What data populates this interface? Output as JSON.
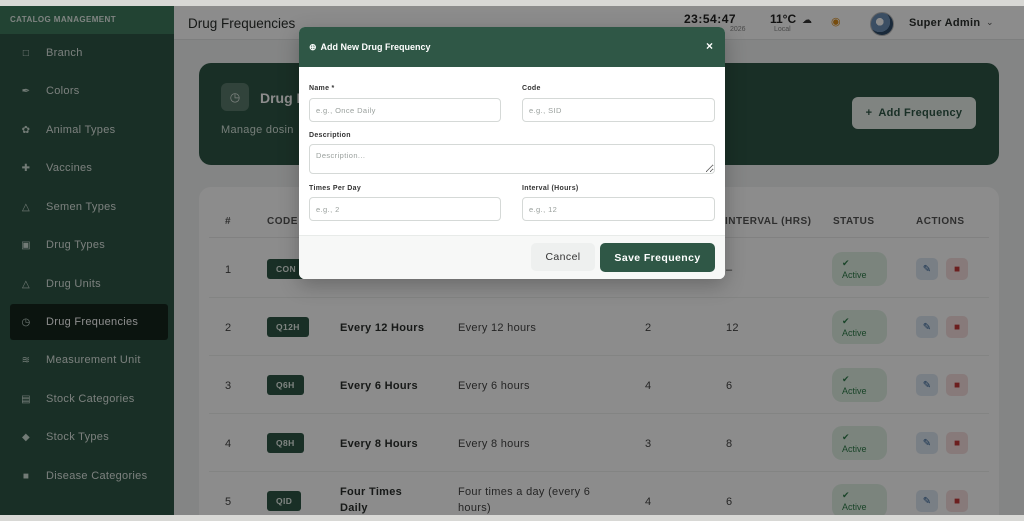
{
  "sidebar": {
    "heading": "CATALOG MANAGEMENT",
    "items": [
      {
        "label": "Branch",
        "icon": "building-icon"
      },
      {
        "label": "Colors",
        "icon": "brush-icon"
      },
      {
        "label": "Animal Types",
        "icon": "paw-icon"
      },
      {
        "label": "Vaccines",
        "icon": "medkit-icon"
      },
      {
        "label": "Semen Types",
        "icon": "flask-icon"
      },
      {
        "label": "Drug Types",
        "icon": "pill-box-icon"
      },
      {
        "label": "Drug Units",
        "icon": "flask-icon"
      },
      {
        "label": "Drug Frequencies",
        "icon": "clock-icon",
        "active": true
      },
      {
        "label": "Measurement Unit",
        "icon": "ruler-icon"
      },
      {
        "label": "Stock Categories",
        "icon": "boxes-icon"
      },
      {
        "label": "Stock Types",
        "icon": "tag-icon"
      },
      {
        "label": "Disease Categories",
        "icon": "folder-icon"
      }
    ]
  },
  "header": {
    "title": "Drug Frequencies",
    "time": "23:54:47",
    "date_partial": "2026",
    "temperature": "11°C",
    "weather_label": "Local",
    "user_name": "Super Admin"
  },
  "banner": {
    "title_partial": "Drug F",
    "subtitle_partial": "Manage dosin",
    "add_button": "Add Frequency"
  },
  "table": {
    "headers": {
      "num": "#",
      "code": "CODE",
      "interval": "INTERVAL (HRS)",
      "status": "STATUS",
      "actions": "ACTIONS"
    },
    "rows": [
      {
        "num": "1",
        "code": "CON",
        "name": "",
        "description": "",
        "times": "",
        "interval": "–",
        "status": "Active"
      },
      {
        "num": "2",
        "code": "Q12H",
        "name": "Every 12 Hours",
        "description": "Every 12 hours",
        "times": "2",
        "interval": "12",
        "status": "Active"
      },
      {
        "num": "3",
        "code": "Q6H",
        "name": "Every 6 Hours",
        "description": "Every 6 hours",
        "times": "4",
        "interval": "6",
        "status": "Active"
      },
      {
        "num": "4",
        "code": "Q8H",
        "name": "Every 8 Hours",
        "description": "Every 8 hours",
        "times": "3",
        "interval": "8",
        "status": "Active"
      },
      {
        "num": "5",
        "code": "QID",
        "name_line1": "Four Times",
        "name_line2": "Daily",
        "description_line1": "Four times a day (every 6",
        "description_line2": "hours)",
        "times": "4",
        "interval": "6",
        "status": "Active"
      }
    ]
  },
  "modal": {
    "title": "Add New Drug Frequency",
    "close_symbol": "×",
    "name_label": "Name *",
    "name_placeholder": "e.g., Once Daily",
    "code_label": "Code",
    "code_placeholder": "e.g., SID",
    "description_label": "Description",
    "description_placeholder": "Description...",
    "times_label": "Times Per Day",
    "times_placeholder": "e.g., 2",
    "interval_label": "Interval (Hours)",
    "interval_placeholder": "e.g., 12",
    "cancel_button": "Cancel",
    "save_button": "Save Frequency"
  },
  "colors": {
    "brand_dark": "#2f5746",
    "status_active_bg": "#e0f0e4",
    "status_active_text": "#2f7d4a"
  }
}
